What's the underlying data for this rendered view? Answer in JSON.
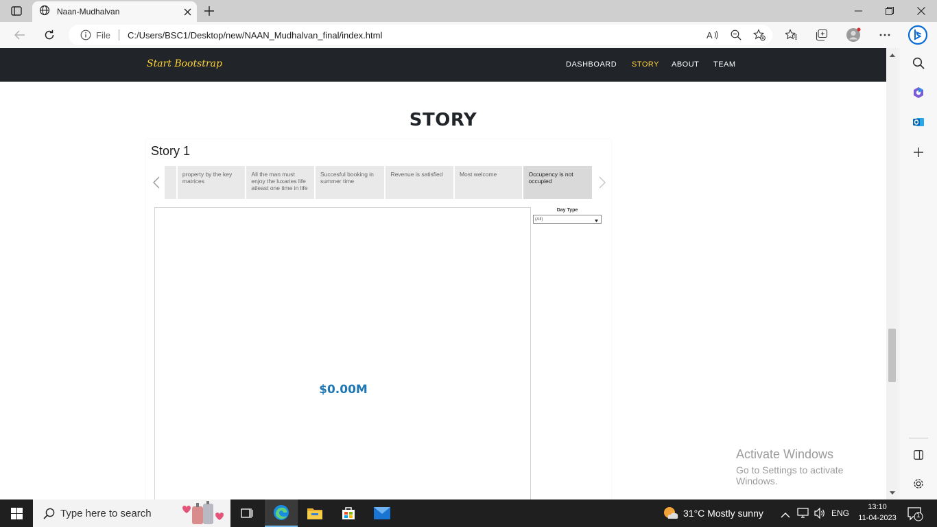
{
  "browser": {
    "tab_title": "Naan-Mudhalvan",
    "file_label": "File",
    "url": "C:/Users/BSC1/Desktop/new/NAAN_Mudhalvan_final/index.html"
  },
  "site": {
    "brand": "Start Bootstrap",
    "nav": [
      {
        "label": "DASHBOARD",
        "active": false
      },
      {
        "label": "STORY",
        "active": true
      },
      {
        "label": "ABOUT",
        "active": false
      },
      {
        "label": "TEAM",
        "active": false
      }
    ],
    "accent_color": "#fed136",
    "nav_bg": "#212529"
  },
  "page": {
    "heading": "STORY"
  },
  "story": {
    "title": "Story 1",
    "points": [
      "property by the key matrices",
      "All the man must enjoy the luxaries life atleast one time in life",
      "Succesful booking in summer time",
      "Revenue is satisfied",
      "Most welcome",
      "Occupency is not occupied"
    ],
    "active_point": 5,
    "kpi_value": "$0.00M",
    "kpi_color": "#1f77b4",
    "filter": {
      "label": "Day Type",
      "value": "(All)"
    }
  },
  "watermark": {
    "line1": "Activate Windows",
    "line2": "Go to Settings to activate Windows."
  },
  "taskbar": {
    "search_placeholder": "Type here to search",
    "weather": "31°C  Mostly sunny",
    "language": "ENG",
    "time": "13:10",
    "date": "11-04-2023",
    "notification_count": "1"
  }
}
